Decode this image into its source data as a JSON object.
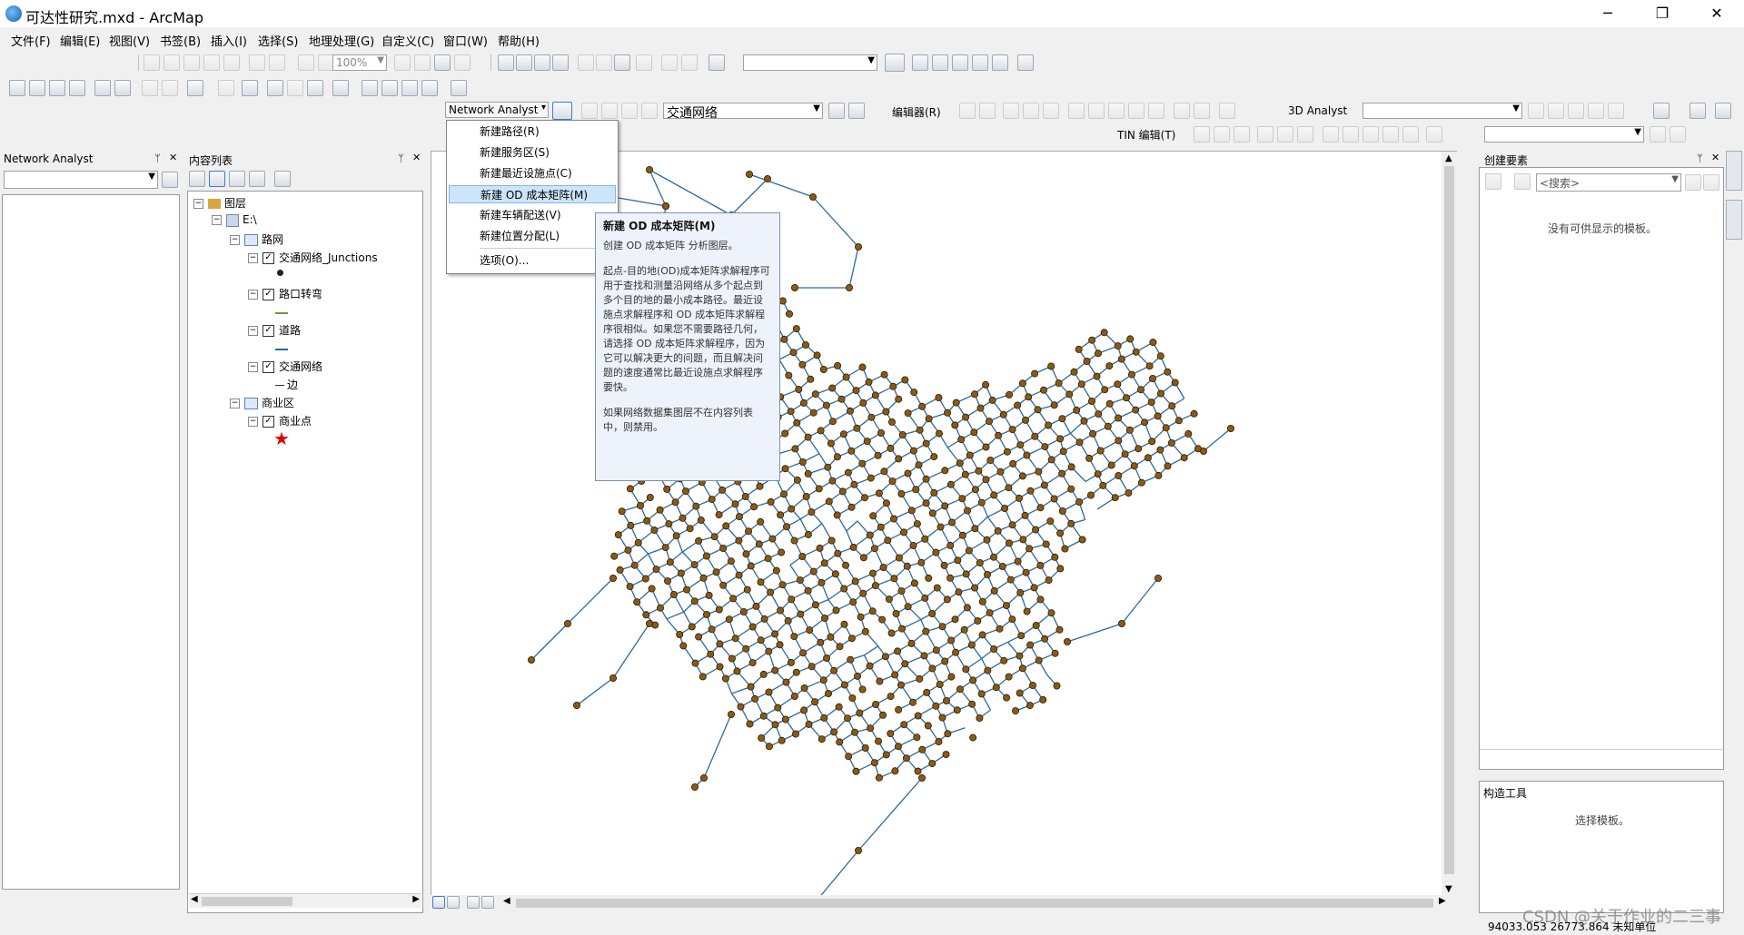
{
  "window": {
    "title": "可达性研究.mxd - ArcMap",
    "minimize": "─",
    "restore": "❐",
    "close": "✕"
  },
  "menu": [
    "文件(F)",
    "编辑(E)",
    "视图(V)",
    "书签(B)",
    "插入(I)",
    "选择(S)",
    "地理处理(G)",
    "自定义(C)",
    "窗口(W)",
    "帮助(H)"
  ],
  "toolbar": {
    "zoom_percent": "100%",
    "network_analyst_label": "Network Analyst",
    "network_combo_value": "交通网络",
    "editor_label": "编辑器(R)",
    "analyst3d_label": "3D Analyst",
    "tin_label": "TIN 编辑(T)"
  },
  "na_panel": {
    "title": "Network Analyst",
    "pin": "ᛘ",
    "close": "✕"
  },
  "toc": {
    "title": "内容列表",
    "pin": "ᛘ",
    "close": "✕",
    "root": "图层",
    "workspace": "E:\\",
    "group_road": "路网",
    "layer_junctions": "交通网络_Junctions",
    "layer_turns": "路口转弯",
    "layer_roads": "道路",
    "layer_network": "交通网络",
    "legend_edge": "边",
    "group_business": "商业区",
    "layer_business_points": "商业点"
  },
  "dropdown": {
    "items": [
      "新建路径(R)",
      "新建服务区(S)",
      "新建最近设施点(C)",
      "新建 OD 成本矩阵(M)",
      "新建车辆配送(V)",
      "新建位置分配(L)",
      "选项(O)..."
    ]
  },
  "tooltip": {
    "title": "新建 OD 成本矩阵(M)",
    "p1": "创建 OD 成本矩阵 分析图层。",
    "p2": "起点-目的地(OD)成本矩阵求解程序可用于查找和测量沿网络从多个起点到多个目的地的最小成本路径。最近设施点求解程序和 OD 成本矩阵求解程序很相似。如果您不需要路径几何，请选择 OD 成本矩阵求解程序，因为它可以解决更大的问题，而且解决问题的速度通常比最近设施点求解程序要快。",
    "p3": "如果网络数据集图层不在内容列表中，则禁用。"
  },
  "create_features": {
    "title": "创建要素",
    "pin": "ᛘ",
    "close": "✕",
    "search_placeholder": "<搜索>",
    "empty_message": "没有可供显示的模板。",
    "construct_title": "构造工具",
    "construct_message": "选择模板。"
  },
  "status": {
    "coords": "94033.053  26773.864 未知单位"
  },
  "watermark": "CSDN @关于作业的二三事",
  "colors": {
    "network_line": "#2a6aa3",
    "junction_fill": "#8b5a12",
    "business_star": "#e00000"
  }
}
